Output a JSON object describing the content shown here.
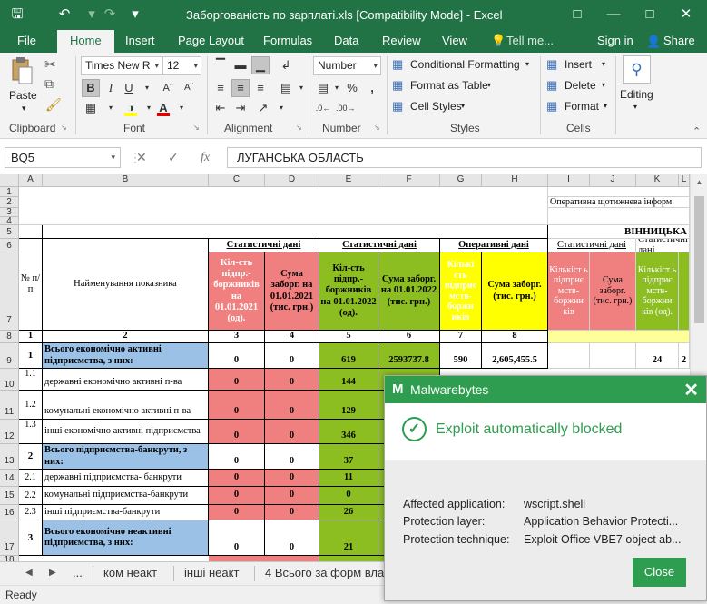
{
  "window": {
    "title": "Заборгованість по зарплаті.xls  [Compatibility Mode] - Excel",
    "save_icon": "save-icon",
    "undo_icon": "undo-icon",
    "redo_icon": "redo-icon",
    "customize_icon": "customize-quick-access-icon"
  },
  "ribbon_tabs": {
    "file": "File",
    "home": "Home",
    "insert": "Insert",
    "page_layout": "Page Layout",
    "formulas": "Formulas",
    "data": "Data",
    "review": "Review",
    "view": "View",
    "tell_me": "Tell me...",
    "sign_in": "Sign in",
    "share": "Share"
  },
  "ribbon": {
    "paste": "Paste",
    "clipboard": "Clipboard",
    "font_name": "Times New R",
    "font_size": "12",
    "font": "Font",
    "alignment": "Alignment",
    "number_format": "Number",
    "number": "Number",
    "conditional_formatting": "Conditional Formatting",
    "format_as_table": "Format as Table",
    "cell_styles": "Cell Styles",
    "styles": "Styles",
    "insert": "Insert",
    "delete": "Delete",
    "format": "Format",
    "cells": "Cells",
    "editing": "Editing",
    "percent": "%"
  },
  "formula_bar": {
    "name_box": "BQ5",
    "fx": "fx",
    "value": "ЛУГАНСЬКА ОБЛАСТЬ"
  },
  "columns": [
    "A",
    "B",
    "C",
    "D",
    "E",
    "F",
    "G",
    "H",
    "I",
    "J",
    "K",
    "L"
  ],
  "rows": [
    "1",
    "2",
    "3",
    "4",
    "5",
    "6",
    "7",
    "8",
    "9",
    "10",
    "11",
    "12",
    "13",
    "14",
    "15",
    "16",
    "17",
    "18"
  ],
  "sheet": {
    "title_right": "Оперативна щотижнева інформ",
    "region_header": "ВІННИЦЬКА",
    "stat_data": "Статистичні  дані",
    "oper_data": "Оперативні дані",
    "no_header": "№ п/п",
    "indicator_header": "Найменування показника",
    "h_c": "Кіл-сть підпр.-боржників на 01.01.2021 (од).",
    "h_d": "Сума заборг. на 01.01.2021 (тис. грн.)",
    "h_e": "Кіл-сть підпр.-боржників на 01.01.2022 (од).",
    "h_f": "Сума заборг. на 01.01.2022 (тис. грн.)",
    "h_g": "Кількі сть підприє мств-боржн иків",
    "h_h": "Сума заборг. (тис. грн.)",
    "h_i": "Кількіст ь підприє мств-боржни ків",
    "h_j": "Сума заборг. (тис. грн.)",
    "h_k": "Кількіст ь підприє мств-боржни ків  (од).",
    "nums": [
      "1",
      "2",
      "3",
      "4",
      "5",
      "6",
      "7",
      "8"
    ],
    "r9": {
      "a": "1",
      "b": "Всього економічно активні підприємства, з них:",
      "c": "0",
      "d": "0",
      "e": "619",
      "f": "2593737.8",
      "g": "590",
      "h": "2,605,455.5",
      "k": "24",
      "l": "2"
    },
    "r10": {
      "a": "1.1",
      "b": "державні економічно активні п-ва",
      "c": "0",
      "d": "0",
      "e": "144"
    },
    "r11": {
      "a": "1.2",
      "b": "комунальні економічно активні п-ва",
      "c": "0",
      "d": "0",
      "e": "129"
    },
    "r12": {
      "a": "1.3",
      "b": "інші економічно активні підприємства",
      "c": "0",
      "d": "0",
      "e": "346"
    },
    "r13": {
      "a": "2",
      "b": "Всього підприємства-банкрути, з них:",
      "c": "0",
      "d": "0",
      "e": "37"
    },
    "r14": {
      "a": "2.1",
      "b": "державні підприємства- банкрути",
      "c": "0",
      "d": "0",
      "e": "11"
    },
    "r15": {
      "a": "2.2",
      "b": "комунальні підприємства-банкрути",
      "c": "0",
      "d": "0",
      "e": "0"
    },
    "r16": {
      "a": "2.3",
      "b": "інші підприємства-банкрути",
      "c": "0",
      "d": "0",
      "e": "26"
    },
    "r17": {
      "a": "3",
      "b": "Всього економічно неактивні підприємства, з них:",
      "c": "0",
      "d": "0",
      "e": "21"
    }
  },
  "sheet_tabs": {
    "more": "...",
    "tab1": "ком неакт",
    "tab2": "інші неакт",
    "tab3": "4 Всього за форм вла"
  },
  "status": "Ready",
  "popup": {
    "brand": "Malwarebytes",
    "headline": "Exploit automatically blocked",
    "affected_label": "Affected application:",
    "affected_value": "wscript.shell",
    "layer_label": "Protection layer:",
    "layer_value": "Application Behavior Protecti...",
    "technique_label": "Protection technique:",
    "technique_value": "Exploit Office VBE7 object ab...",
    "close": "Close",
    "accent": "#2e9d4f"
  },
  "colors": {
    "excel_green": "#217346",
    "cell_red": "#f08080",
    "cell_green": "#8cbe22",
    "cell_yellow": "#ffff00",
    "cell_blue": "#9bc2e6"
  }
}
